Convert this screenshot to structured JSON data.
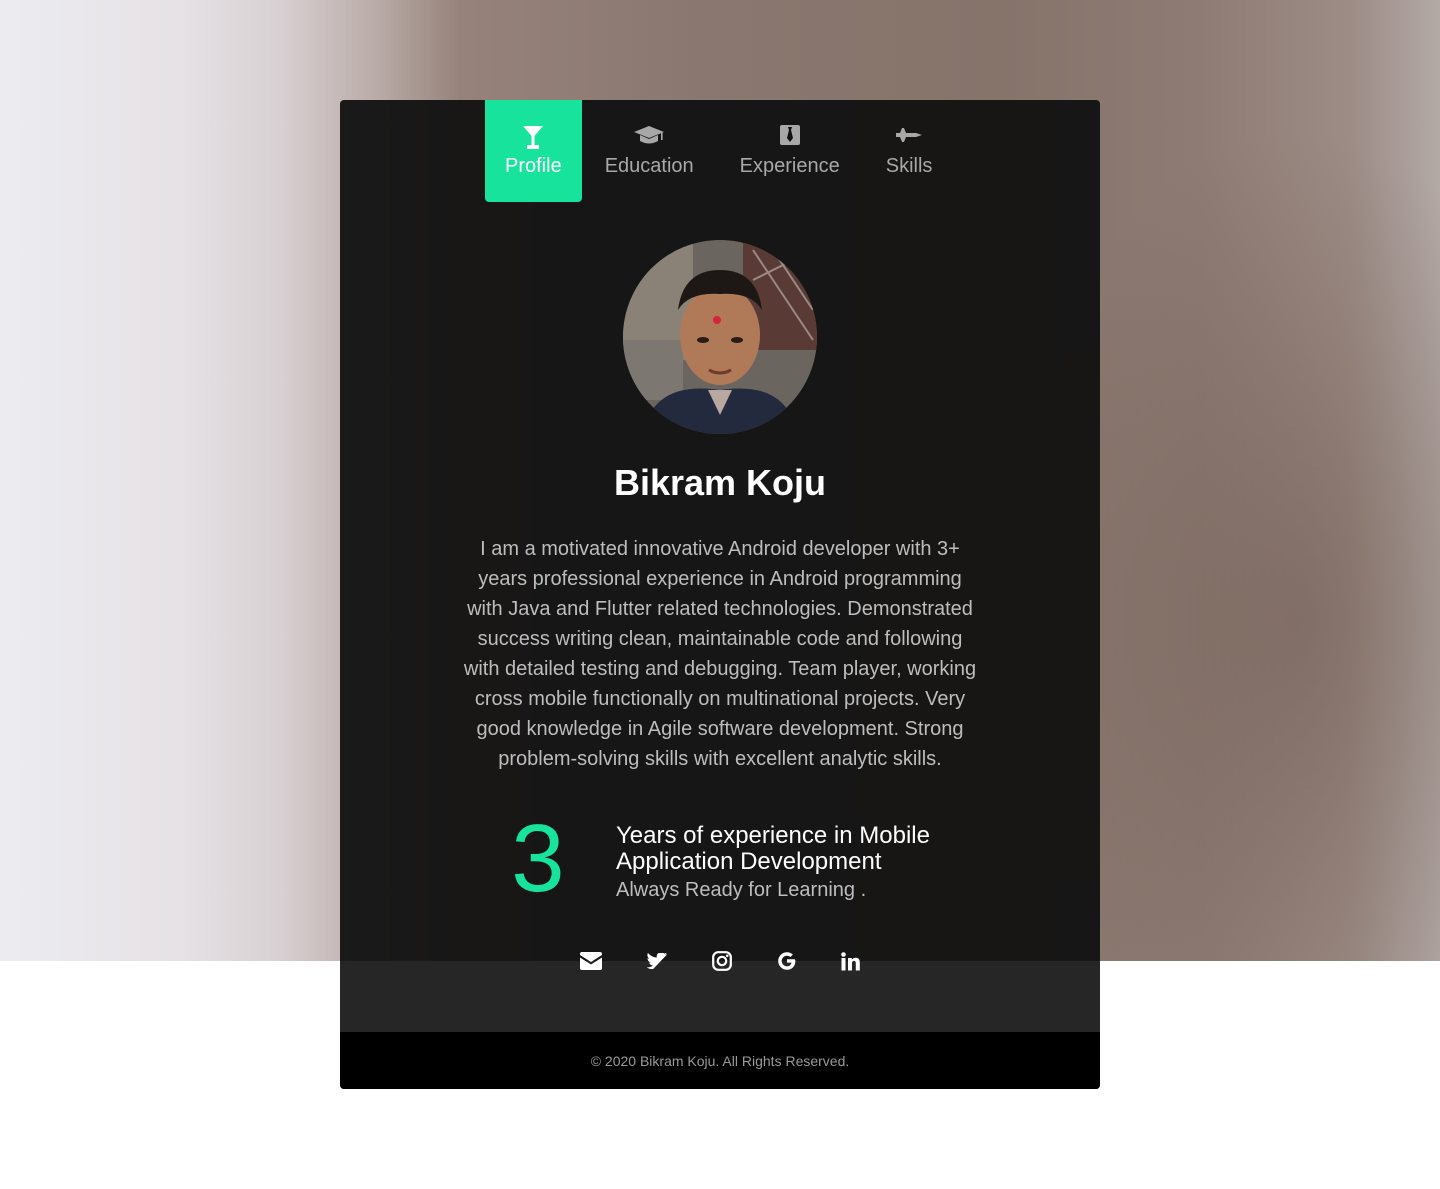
{
  "tabs": [
    {
      "label": "Profile",
      "icon": "cocktail-glass-icon",
      "active": true
    },
    {
      "label": "Education",
      "icon": "graduation-cap-icon",
      "active": false
    },
    {
      "label": "Experience",
      "icon": "id-badge-icon",
      "active": false
    },
    {
      "label": "Skills",
      "icon": "fighter-jet-icon",
      "active": false
    }
  ],
  "profile": {
    "name": "Bikram Koju",
    "bio": "I am a motivated innovative Android developer with 3+ years professional experience in Android programming with Java and Flutter related technologies. Demonstrated success writing clean, maintainable code and following with detailed testing and debugging. Team player, working cross mobile functionally on multinational projects. Very good knowledge in Agile software development. Strong problem-solving skills with excellent analytic skills.",
    "stat_number": "3",
    "stat_title": "Years of experience in Mobile Application Development",
    "stat_subtitle": "Always Ready for Learning ."
  },
  "social": [
    {
      "icon": "envelope-icon"
    },
    {
      "icon": "twitter-icon"
    },
    {
      "icon": "instagram-icon"
    },
    {
      "icon": "google-icon"
    },
    {
      "icon": "linkedin-icon"
    }
  ],
  "footer": {
    "copyright": "© 2020 Bikram Koju. All Rights Reserved."
  },
  "colors": {
    "accent": "#17e39d",
    "card": "#111111",
    "footer": "#000000"
  }
}
